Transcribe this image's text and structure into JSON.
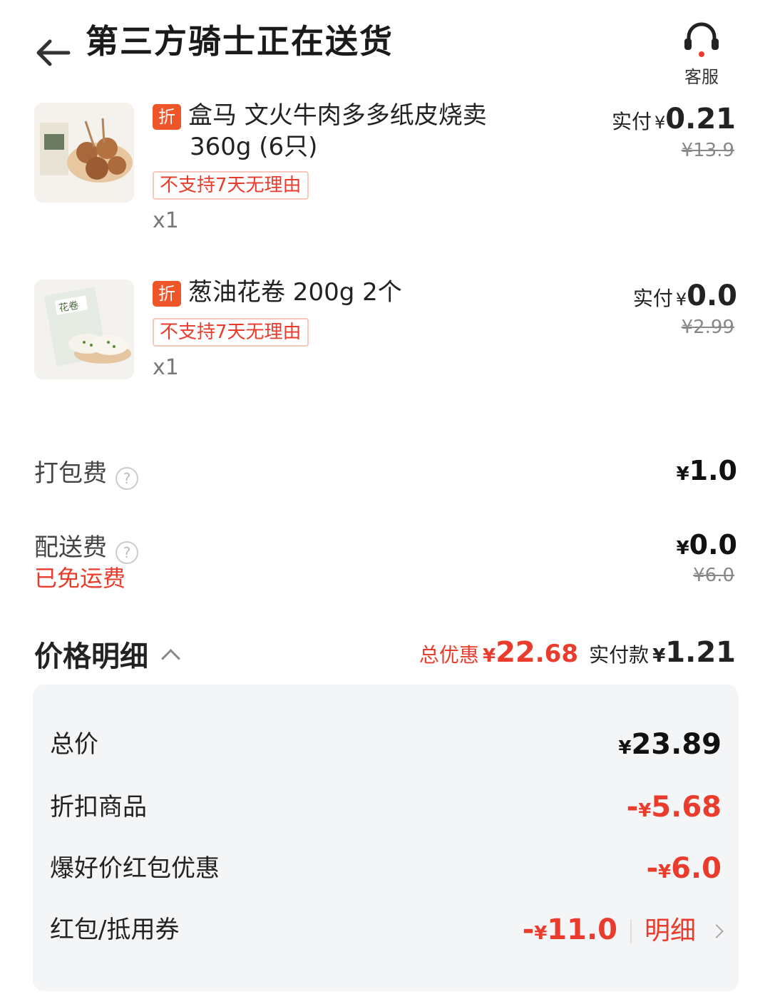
{
  "header": {
    "title": "第三方骑士正在送货",
    "service_label": "客服"
  },
  "products": [
    {
      "tag": "折",
      "name_line1": "盒马 文火牛肉多多纸皮烧卖",
      "name_line2": "360g (6只)",
      "badge": "不支持7天无理由",
      "qty": "x1",
      "pay_label": "实付",
      "pay_currency": "¥",
      "pay_amount": "0.21",
      "orig_price": "¥13.9"
    },
    {
      "tag": "折",
      "name_line1": "葱油花卷 200g 2个",
      "badge": "不支持7天无理由",
      "qty": "x1",
      "pay_label": "实付",
      "pay_currency": "¥",
      "pay_amount": "0.0",
      "orig_price": "¥2.99"
    }
  ],
  "fees": {
    "packing": {
      "label": "打包费",
      "currency": "¥",
      "amount": "1.0"
    },
    "delivery": {
      "label": "配送费",
      "note": "已免运费",
      "currency": "¥",
      "amount": "0.0",
      "orig": "¥6.0"
    }
  },
  "price_detail": {
    "title": "价格明细",
    "total_discount_label": "总优惠",
    "total_discount_currency": "¥",
    "total_discount_int": "22",
    "total_discount_dec": ".68",
    "paid_label": "实付款",
    "paid_currency": "¥",
    "paid_amount": "1.21",
    "rows": [
      {
        "label": "总价",
        "prefix": "",
        "currency": "¥",
        "amount": "23.89"
      },
      {
        "label": "折扣商品",
        "prefix": "-",
        "currency": "¥",
        "amount": "5.68"
      },
      {
        "label": "爆好价红包优惠",
        "prefix": "-",
        "currency": "¥",
        "amount": "6.0"
      },
      {
        "label": "红包/抵用券",
        "prefix": "-",
        "currency": "¥",
        "amount": "11.0",
        "link": "明细"
      }
    ]
  },
  "colors": {
    "accent_red": "#ea3c2c",
    "tag_orange": "#f0552a",
    "panel_bg": "#f4f5f7"
  }
}
